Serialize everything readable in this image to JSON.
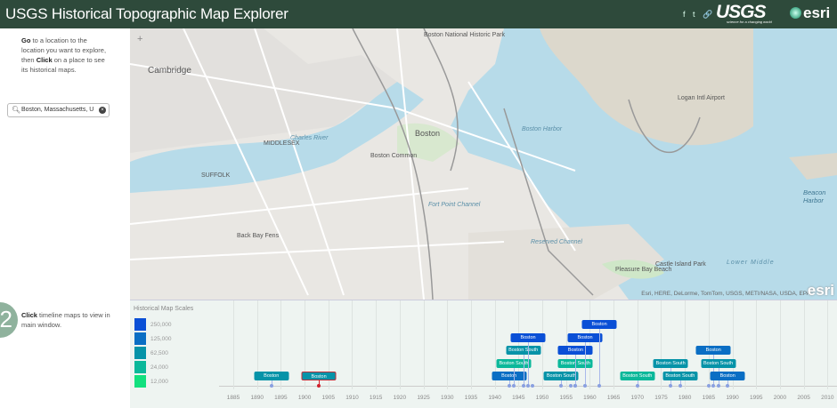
{
  "header": {
    "title": "USGS Historical Topographic Map Explorer",
    "usgs_logo": "USGS",
    "usgs_tagline": "science for a changing world",
    "esri_logo": "esri",
    "social": [
      "facebook-icon",
      "twitter-icon",
      "link-icon"
    ]
  },
  "sidebar": {
    "step1_bold1": "Go",
    "step1_text1": " to a location to the location you want to explore, then ",
    "step1_bold2": "Click",
    "step1_text2": " on a place to see its historical maps.",
    "search_value": "Boston, Massachusetts, U",
    "step2_number": "2",
    "step2_bold": "Click",
    "step2_text": " timeline maps to view in main window."
  },
  "map": {
    "labels": [
      {
        "t": "Cambridge",
        "c": ""
      },
      {
        "t": "Boston",
        "c": ""
      },
      {
        "t": "Boston Harbor",
        "c": "water"
      },
      {
        "t": "Logan Intl Airport",
        "c": ""
      },
      {
        "t": "Charles River",
        "c": "water"
      },
      {
        "t": "SUFFOLK",
        "c": ""
      },
      {
        "t": "MIDDLESEX",
        "c": ""
      },
      {
        "t": "Lower Middle",
        "c": "water"
      },
      {
        "t": "Reserved Channel",
        "c": "water"
      },
      {
        "t": "Pleasure Bay Beach",
        "c": ""
      },
      {
        "t": "Castle Island Park",
        "c": ""
      },
      {
        "t": "Fort Point Channel",
        "c": "water"
      },
      {
        "t": "Back Bay Fens",
        "c": ""
      },
      {
        "t": "Boston Common",
        "c": ""
      },
      {
        "t": "Beacon Harbor",
        "c": "water"
      },
      {
        "t": "Boston National Historic Park",
        "c": ""
      }
    ],
    "attribution": "Esri, HERE, DeLorme, TomTom, USGS, METI/NASA, USDA, EPA",
    "zoom_in": "+"
  },
  "timeline": {
    "legend_title": "Historical Map Scales",
    "scales": [
      {
        "label": "250,000",
        "color": "#0a4fd6"
      },
      {
        "label": "125,000",
        "color": "#0a6ec4"
      },
      {
        "label": "62,500",
        "color": "#0693a8"
      },
      {
        "label": "24,000",
        "color": "#0bb89a"
      },
      {
        "label": "12,000",
        "color": "#12e07e"
      }
    ],
    "year_min": 1882,
    "year_max": 2012,
    "ticks": [
      "1885",
      "1890",
      "1895",
      "1900",
      "1905",
      "1910",
      "1915",
      "1920",
      "1925",
      "1930",
      "1935",
      "1940",
      "1945",
      "1950",
      "1955",
      "1960",
      "1965",
      "1970",
      "1975",
      "1980",
      "1985",
      "1990",
      "1995",
      "2000",
      "2005",
      "2010"
    ],
    "maps": [
      {
        "name": "Boston",
        "year": 1893,
        "row": 1,
        "scale": 2,
        "selected": false
      },
      {
        "name": "Boston",
        "year": 1903,
        "row": 1,
        "scale": 2,
        "selected": true
      },
      {
        "name": "Boston",
        "year": 1943,
        "row": 1,
        "scale": 1,
        "selected": false
      },
      {
        "name": "Boston South",
        "year": 1944,
        "row": 2,
        "scale": 3,
        "selected": false
      },
      {
        "name": "Boston South",
        "year": 1946,
        "row": 3,
        "scale": 2,
        "selected": false
      },
      {
        "name": "Boston",
        "year": 1947,
        "row": 4,
        "scale": 0,
        "selected": false
      },
      {
        "name": "Boston South",
        "year": 1954,
        "row": 1,
        "scale": 2,
        "selected": false
      },
      {
        "name": "Boston South",
        "year": 1957,
        "row": 2,
        "scale": 3,
        "selected": false
      },
      {
        "name": "Boston",
        "year": 1957,
        "row": 3,
        "scale": 0,
        "selected": false
      },
      {
        "name": "Boston",
        "year": 1959,
        "row": 4,
        "scale": 0,
        "selected": false
      },
      {
        "name": "Boston",
        "year": 1962,
        "row": 5,
        "scale": 0,
        "selected": false
      },
      {
        "name": "Boston South",
        "year": 1970,
        "row": 1,
        "scale": 3,
        "selected": false
      },
      {
        "name": "Boston South",
        "year": 1977,
        "row": 2,
        "scale": 2,
        "selected": false
      },
      {
        "name": "Boston South",
        "year": 1979,
        "row": 1,
        "scale": 2,
        "selected": false
      },
      {
        "name": "Boston",
        "year": 1986,
        "row": 3,
        "scale": 1,
        "selected": false
      },
      {
        "name": "Boston South",
        "year": 1987,
        "row": 2,
        "scale": 2,
        "selected": false
      },
      {
        "name": "Boston",
        "year": 1989,
        "row": 1,
        "scale": 1,
        "selected": false
      }
    ],
    "extra_dots": [
      1948,
      1956,
      1985
    ]
  }
}
